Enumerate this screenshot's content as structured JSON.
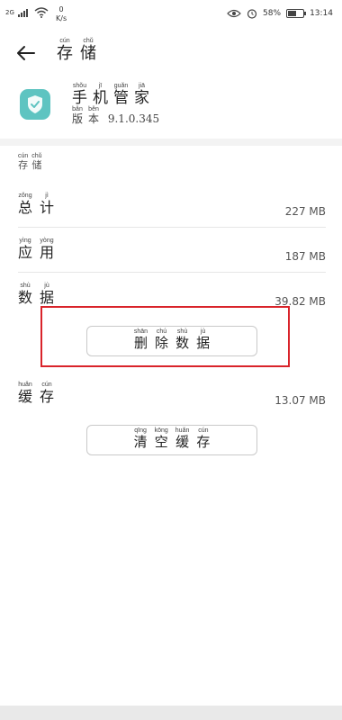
{
  "status_bar": {
    "network": "2G",
    "net_speed_value": "0",
    "net_speed_unit": "K/s",
    "battery_percent": "58",
    "time": "13:14"
  },
  "header": {
    "back_icon": "arrow-left-icon",
    "title_chars": [
      {
        "han": "存",
        "pinyin": "cún"
      },
      {
        "han": "储",
        "pinyin": "chǔ"
      }
    ]
  },
  "app": {
    "icon": "shield-check-icon",
    "name_chars": [
      {
        "han": "手",
        "pinyin": "shǒu"
      },
      {
        "han": "机",
        "pinyin": "jī"
      },
      {
        "han": "管",
        "pinyin": "guǎn"
      },
      {
        "han": "家",
        "pinyin": "jiā"
      }
    ],
    "version_chars": [
      {
        "han": "版",
        "pinyin": "bǎn"
      },
      {
        "han": "本",
        "pinyin": "běn"
      }
    ],
    "version_number": "9.1.0.345"
  },
  "storage": {
    "section_chars": [
      {
        "han": "存",
        "pinyin": "cún"
      },
      {
        "han": "储",
        "pinyin": "chǔ"
      }
    ],
    "rows": [
      {
        "chars": [
          {
            "han": "总",
            "pinyin": "zǒng"
          },
          {
            "han": "计",
            "pinyin": "jì"
          }
        ],
        "value": "227 MB"
      },
      {
        "chars": [
          {
            "han": "应",
            "pinyin": "yìng"
          },
          {
            "han": "用",
            "pinyin": "yòng"
          }
        ],
        "value": "187 MB"
      },
      {
        "chars": [
          {
            "han": "数",
            "pinyin": "shù"
          },
          {
            "han": "据",
            "pinyin": "jù"
          }
        ],
        "value": "39.82 MB"
      },
      {
        "chars": [
          {
            "han": "缓",
            "pinyin": "huǎn"
          },
          {
            "han": "存",
            "pinyin": "cún"
          }
        ],
        "value": "13.07 MB"
      }
    ],
    "delete_data_button_chars": [
      {
        "han": "删",
        "pinyin": "shān"
      },
      {
        "han": "除",
        "pinyin": "chú"
      },
      {
        "han": "数",
        "pinyin": "shù"
      },
      {
        "han": "据",
        "pinyin": "jù"
      }
    ],
    "clear_cache_button_chars": [
      {
        "han": "清",
        "pinyin": "qīng"
      },
      {
        "han": "空",
        "pinyin": "kōng"
      },
      {
        "han": "缓",
        "pinyin": "huǎn"
      },
      {
        "han": "存",
        "pinyin": "cún"
      }
    ]
  },
  "colors": {
    "highlight": "#d9232a",
    "app_icon_bg": "#5ec4c1"
  }
}
